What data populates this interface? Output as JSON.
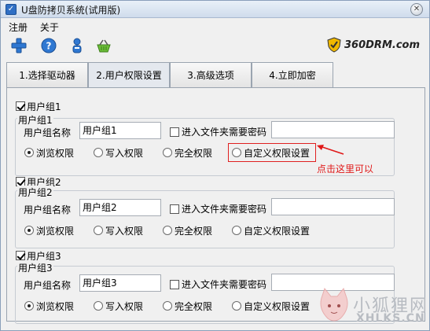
{
  "window": {
    "title": "U盘防拷贝系统(试用版)"
  },
  "menu": [
    "注册",
    "关于"
  ],
  "toolbar": {
    "icons": [
      "add-icon",
      "help-icon",
      "user-icon",
      "basket-icon"
    ]
  },
  "brand": {
    "text": "360DRM.com"
  },
  "tabs": [
    {
      "label": "1.选择驱动器"
    },
    {
      "label": "2.用户权限设置",
      "active": true
    },
    {
      "label": "3.高级选项"
    },
    {
      "label": "4.立即加密"
    }
  ],
  "labels": {
    "group_name": "用户组名称",
    "folder_pwd": "进入文件夹需要密码",
    "browse": "浏览权限",
    "write": "写入权限",
    "full": "完全权限",
    "custom": "自定义权限设置"
  },
  "groups": [
    {
      "check_label": "用户组1",
      "legend": "用户组1",
      "name_value": "用户组1",
      "checked": true,
      "pwd_checked": false,
      "selected": "browse"
    },
    {
      "check_label": "用户组2",
      "legend": "用户组2",
      "name_value": "用户组2",
      "checked": true,
      "pwd_checked": false,
      "selected": "browse"
    },
    {
      "check_label": "用户组3",
      "legend": "用户组3",
      "name_value": "用户组3",
      "checked": true,
      "pwd_checked": false,
      "selected": "browse"
    }
  ],
  "annotation": {
    "text": "点击这里可以",
    "color": "#e01818"
  },
  "watermark": {
    "line1": "小狐狸网",
    "line2": "XHLKS.CN"
  },
  "colors": {
    "accent": "#2f6fc4",
    "annotation": "#e01818"
  }
}
